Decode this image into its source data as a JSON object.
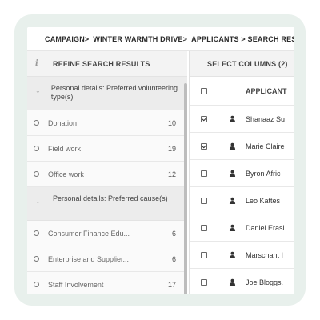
{
  "breadcrumb": [
    "CAMPAIGN>",
    "WINTER WARMTH DRIVE>",
    "APPLICANTS > SEARCH RESU"
  ],
  "left_panel": {
    "header": "REFINE SEARCH RESULTS",
    "groups": [
      {
        "title": "Personal details: Preferred volunteering type(s)",
        "options": [
          {
            "label": "Donation",
            "count": "10"
          },
          {
            "label": "Field work",
            "count": "19"
          },
          {
            "label": "Office work",
            "count": "12"
          }
        ]
      },
      {
        "title": "Personal details: Preferred cause(s)",
        "options": [
          {
            "label": "Consumer Finance Edu...",
            "count": "6"
          },
          {
            "label": "Enterprise and Supplier...",
            "count": "6"
          },
          {
            "label": "Staff Involvement",
            "count": "17"
          }
        ]
      }
    ]
  },
  "right_panel": {
    "header": "SELECT COLUMNS  (2)",
    "column_header": "APPLICANT",
    "rows": [
      {
        "name": "Shanaaz Su",
        "checked": true
      },
      {
        "name": "Marie Claire",
        "checked": true
      },
      {
        "name": "Byron Afric",
        "checked": false
      },
      {
        "name": "Leo Kattes",
        "checked": false
      },
      {
        "name": "Daniel Erasi",
        "checked": false
      },
      {
        "name": "Marschant I",
        "checked": false
      },
      {
        "name": "Joe Bloggs.",
        "checked": false
      }
    ]
  },
  "colors": {
    "frame": "#e8f0ec",
    "panel_header": "#f3f3f3",
    "group_header": "#ececec"
  }
}
